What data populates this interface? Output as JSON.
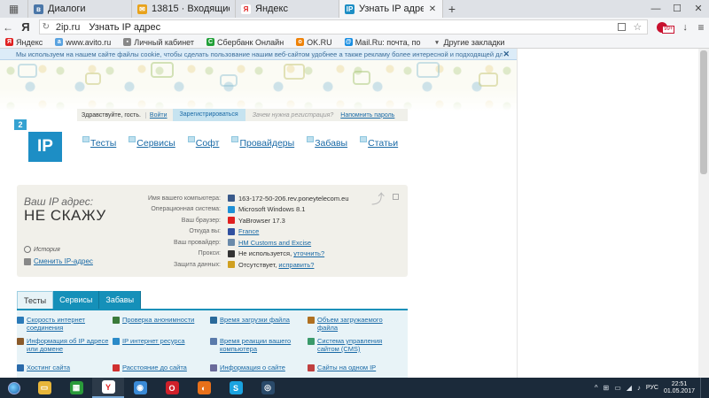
{
  "browser": {
    "home_icon": "grid-icon",
    "tabs": [
      {
        "title": "Диалоги",
        "icon": "vk-icon",
        "color": "#4a76a8",
        "glyph": "в",
        "active": false
      },
      {
        "title": "13815 · Входящие — Яндекс",
        "icon": "mail-icon",
        "color": "#e8a21b",
        "glyph": "✉",
        "active": false
      },
      {
        "title": "Яндекс",
        "icon": "yandex-icon",
        "color": "#ffffff",
        "glyph": "Я",
        "active": false
      },
      {
        "title": "Узнать IP адрес",
        "icon": "2ip-icon",
        "color": "#1d8ec5",
        "glyph": "IP",
        "active": true
      }
    ],
    "new_tab": "+",
    "window_controls": {
      "minimize": "—",
      "maximize": "☐",
      "close": "✕"
    },
    "address": {
      "host": "2ip.ru",
      "page_title": "Узнать IP адрес"
    },
    "bookmarks": [
      {
        "label": "Яндекс",
        "color": "#e02020",
        "glyph": "Я"
      },
      {
        "label": "www.avito.ru",
        "color": "#5aa3e0",
        "glyph": "a"
      },
      {
        "label": "Личный кабинет",
        "color": "#888888",
        "glyph": "▪"
      },
      {
        "label": "Сбербанк Онлайн",
        "color": "#21a038",
        "glyph": "С"
      },
      {
        "label": "OK.RU",
        "color": "#ee8208",
        "glyph": "о"
      },
      {
        "label": "Mail.Ru: почта, по",
        "color": "#168de2",
        "glyph": "@"
      },
      {
        "label": "Другие закладки",
        "color": "#f4f5f7",
        "glyph": "▾"
      }
    ]
  },
  "page": {
    "cookie_notice": "Мы используем на нашем сайте файлы cookie, чтобы сделать пользование нашим веб-сайтом удобнее а также рекламу более интересной и подходящей для вас.",
    "cookie_close": "✕",
    "login": {
      "hello": "Здравствуйте, гость.",
      "login": "Войти",
      "register": "Зарегистрироваться",
      "why": "Зачем нужна регистрация?",
      "remind": "Напомнить пароль"
    },
    "logo": {
      "badge": "2",
      "text": "IP"
    },
    "menu": [
      "Тесты",
      "Сервисы",
      "Софт",
      "Провайдеры",
      "Забавы",
      "Статьи"
    ],
    "ip_panel": {
      "your_ip_label": "Ваш IP адрес:",
      "ip_value": "НЕ СКАЖУ",
      "history": "История",
      "change_ip": "Сменить IP-адрес",
      "rows": [
        {
          "label": "Имя вашего компьютера:",
          "value": "163-172-50-206.rev.poneytelecom.eu",
          "icon": "computer-icon",
          "color": "#3a5a8a",
          "link": false
        },
        {
          "label": "Операционная система:",
          "value": "Microsoft Windows 8.1",
          "icon": "windows-icon",
          "color": "#1e90d6",
          "link": false
        },
        {
          "label": "Ваш браузер:",
          "value": "YaBrowser 17.3",
          "icon": "yandex-browser-icon",
          "color": "#e02020",
          "link": false
        },
        {
          "label": "Откуда вы:",
          "value": "France",
          "icon": "france-flag-icon",
          "color": "#3050a0",
          "link": true
        },
        {
          "label": "Ваш провайдер:",
          "value": "HM Customs and Excise",
          "icon": "provider-icon",
          "color": "#6a8aaa",
          "link": true
        },
        {
          "label": "Прокси:",
          "value": "Не используется,",
          "extra": "уточнить?",
          "icon": "glasses-icon",
          "color": "#333333",
          "link": false
        },
        {
          "label": "Защита данных:",
          "value": "Отсутствует,",
          "extra": "исправить?",
          "icon": "shield-icon",
          "color": "#d0a020",
          "link": false
        }
      ]
    },
    "service_tabs": [
      "Тесты",
      "Сервисы",
      "Забавы"
    ],
    "services": [
      {
        "label": "Скорость интернет соединения",
        "icon": "speed-icon",
        "color": "#2a7ab8"
      },
      {
        "label": "Проверка анонимности",
        "icon": "anon-icon",
        "color": "#3a7a3a"
      },
      {
        "label": "Время загрузки файла",
        "icon": "clock-icon",
        "color": "#2a6a9a"
      },
      {
        "label": "Объем загружаемого файла",
        "icon": "file-size-icon",
        "color": "#b07020"
      },
      {
        "label": "Информация об IP адресе или домене",
        "icon": "info-icon",
        "color": "#8a5a2a"
      },
      {
        "label": "IP интернет ресурса",
        "icon": "globe-icon",
        "color": "#2a8ac8"
      },
      {
        "label": "Время реакции вашего компьютера",
        "icon": "reaction-icon",
        "color": "#5a7aaa"
      },
      {
        "label": "Система управления сайтом (CMS)",
        "icon": "cms-icon",
        "color": "#3a9a6a"
      },
      {
        "label": "Хостинг сайта",
        "icon": "hosting-icon",
        "color": "#2a6aaa"
      },
      {
        "label": "Расстояние до сайта",
        "icon": "pin-icon",
        "color": "#d03030"
      },
      {
        "label": "Информация о сайте",
        "icon": "site-info-icon",
        "color": "#6a6a9a"
      },
      {
        "label": "Сайты на одном IP",
        "icon": "sites-icon",
        "color": "#c04040"
      }
    ]
  },
  "taskbar": {
    "apps": [
      {
        "name": "file-explorer-icon",
        "color": "#e8b63a",
        "glyph": "▭",
        "open": false
      },
      {
        "name": "store-icon",
        "color": "#2a9a3a",
        "glyph": "▦",
        "open": false
      },
      {
        "name": "yandex-browser-icon",
        "color": "#ffffff",
        "glyph": "Y",
        "open": true
      },
      {
        "name": "chrome-icon",
        "color": "#3a8ad6",
        "glyph": "◉",
        "open": false
      },
      {
        "name": "opera-icon",
        "color": "#d0202a",
        "glyph": "O",
        "open": false
      },
      {
        "name": "firefox-icon",
        "color": "#e8701a",
        "glyph": "◐",
        "open": false
      },
      {
        "name": "skype-icon",
        "color": "#1aa3e0",
        "glyph": "S",
        "open": false
      },
      {
        "name": "steam-icon",
        "color": "#2a4a6a",
        "glyph": "◎",
        "open": false
      }
    ],
    "tray": {
      "icons": [
        "^",
        "⊞",
        "▭",
        "◢",
        "♪"
      ],
      "lang": "РУС",
      "time": "22:51",
      "date": "01.05.2017"
    }
  }
}
